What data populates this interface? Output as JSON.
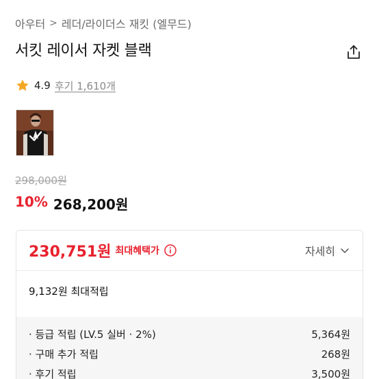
{
  "breadcrumb": {
    "level1": "아우터",
    "separator": ">",
    "level2": "레더/라이더스 재킷 (엘무드)"
  },
  "product": {
    "title": "서킷 레이서 자켓 블랙",
    "rating": "4.9",
    "review_link": "후기 1,610개",
    "thumbnail_alt": "jacket thumbnail"
  },
  "price": {
    "original": "298,000원",
    "discount": "10%",
    "sale": "268,200원"
  },
  "benefit": {
    "max_price": "230,751원",
    "max_label": "최대혜택가",
    "details_label": "자세히",
    "points_total": "9,132원 최대적립",
    "breakdown": [
      {
        "label": "· 등급 적립 (LV.5 실버 · 2%)",
        "value": "5,364원"
      },
      {
        "label": "· 구매 추가 적립",
        "value": "268원"
      },
      {
        "label": "· 후기 적립",
        "value": "3,500원"
      }
    ]
  },
  "colors": {
    "accent_red": "#e8222f",
    "star": "#f5a623",
    "muted": "#8a8a8a"
  },
  "icons": {
    "share": "share-icon",
    "star": "star-icon",
    "info": "info-icon",
    "chevron": "chevron-down-icon"
  }
}
